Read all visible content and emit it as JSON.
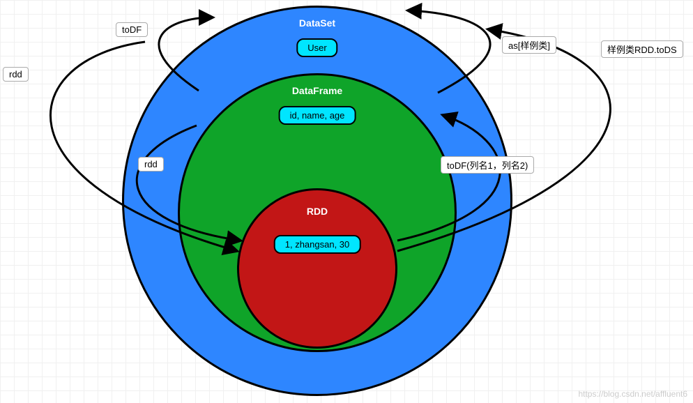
{
  "rings": {
    "outer": {
      "title": "DataSet",
      "sample": "User"
    },
    "middle": {
      "title": "DataFrame",
      "sample": "id, name, age"
    },
    "inner": {
      "title": "RDD",
      "sample": "1, zhangsan, 30"
    }
  },
  "labels": {
    "toDF": "toDF",
    "rdd_left": "rdd",
    "rdd_mid": "rdd",
    "as_sample": "as[样例类]",
    "sample_rdd_tods": "样例类RDD.toDS",
    "toDF_cols": "toDF(列名1，列名2)"
  },
  "watermark": "https://blog.csdn.net/affluent6"
}
